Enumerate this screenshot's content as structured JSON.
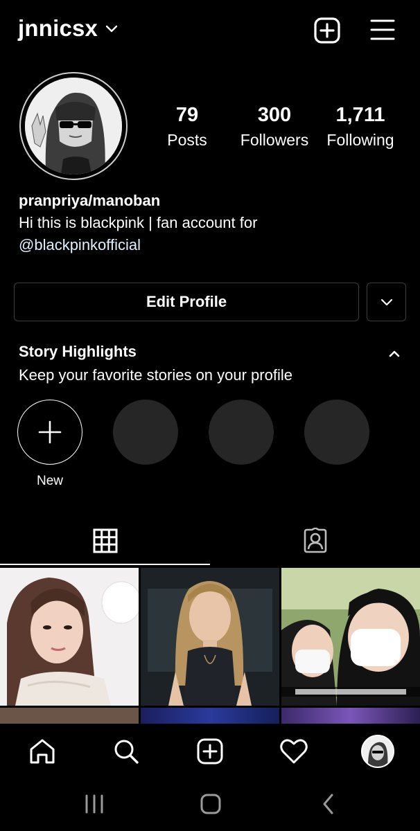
{
  "header": {
    "username": "jnnicsx",
    "dropdown_icon": "chevron-down-icon",
    "add_icon": "plus-square-icon",
    "menu_icon": "hamburger-menu-icon"
  },
  "stats": {
    "posts": {
      "count": "79",
      "label": "Posts"
    },
    "followers": {
      "count": "300",
      "label": "Followers"
    },
    "following": {
      "count": "1,711",
      "label": "Following"
    }
  },
  "bio": {
    "name": "pranpriya/manoban",
    "line1": "Hi this is blackpink | fan account for",
    "mention": "@blackpinkofficial"
  },
  "actions": {
    "edit_profile": "Edit Profile",
    "more_icon": "chevron-down-icon"
  },
  "highlights": {
    "title": "Story Highlights",
    "subtitle": "Keep your favorite stories on your profile",
    "new_label": "New"
  },
  "tabs": [
    {
      "icon": "grid-icon",
      "active": true
    },
    {
      "icon": "tagged-person-icon",
      "active": false
    }
  ],
  "bottom_nav": [
    "home-icon",
    "search-icon",
    "add-post-icon",
    "heart-icon",
    "profile-avatar"
  ],
  "colors": {
    "background": "#000000",
    "mention": "#e0f1ff",
    "border": "#3e3e3e",
    "highlight_placeholder": "#262626"
  }
}
